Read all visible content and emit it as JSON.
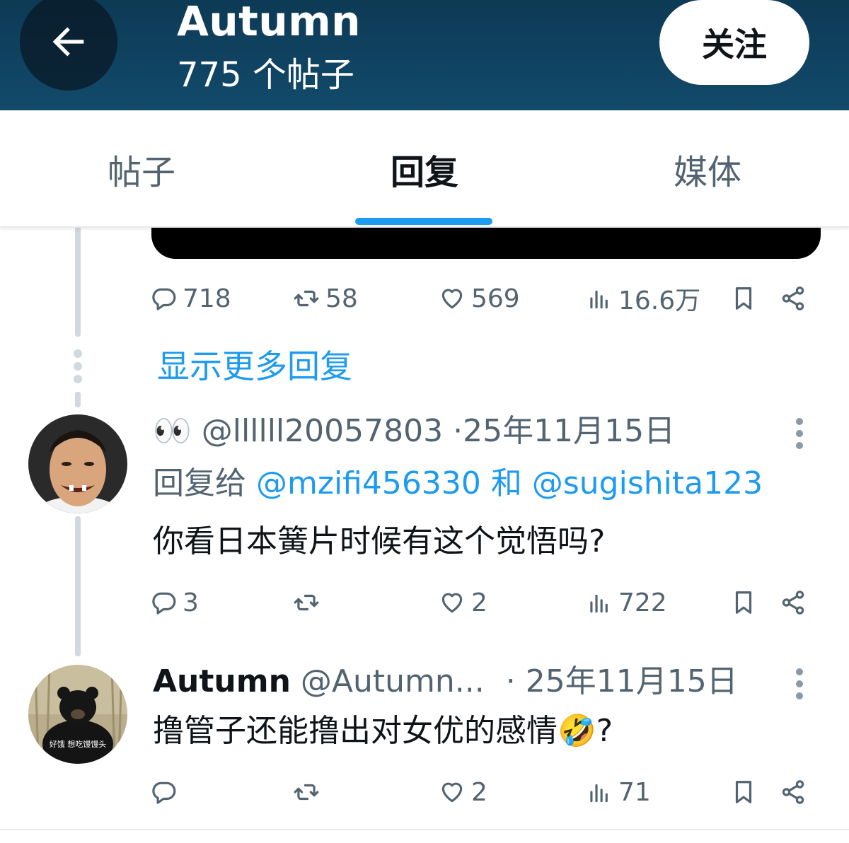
{
  "header": {
    "title": "Autumn",
    "subtitle": "775 个帖子",
    "follow_label": "关注",
    "background": "#124a6b"
  },
  "tabs": [
    {
      "label": "帖子",
      "active": false
    },
    {
      "label": "回复",
      "active": true
    },
    {
      "label": "媒体",
      "active": false
    }
  ],
  "accent_color": "#1d9bf0",
  "post_stats": {
    "replies": "718",
    "reposts": "58",
    "likes": "569",
    "views": "16.6万"
  },
  "show_more_label": "显示更多回复",
  "tweets": [
    {
      "emoji_prefix": "👀",
      "handle": "@llllll20057803",
      "separator": "·",
      "date": "25年11月15日",
      "reply_prefix": "回复给",
      "reply_mention_1": "@mzifi456330",
      "reply_joiner": "和",
      "reply_mention_2": "@sugishita123",
      "text": "你看日本簧片时候有这个觉悟吗?",
      "replies": "3",
      "reposts": "",
      "likes": "2",
      "views": "722"
    },
    {
      "name": "Autumn",
      "handle": "@Autumn...",
      "separator": "·",
      "date": "25年11月15日",
      "text": "撸管子还能撸出对女优的感情🤣?",
      "avatar_caption": "好饿 想吃馒馒头",
      "replies": "",
      "reposts": "",
      "likes": "2",
      "views": "71"
    }
  ],
  "icons": {
    "back": "arrow-left-icon",
    "reply": "reply-icon",
    "repost": "repost-icon",
    "like": "heart-icon",
    "views": "views-icon",
    "bookmark": "bookmark-icon",
    "share": "share-icon",
    "more": "more-vertical-icon"
  }
}
